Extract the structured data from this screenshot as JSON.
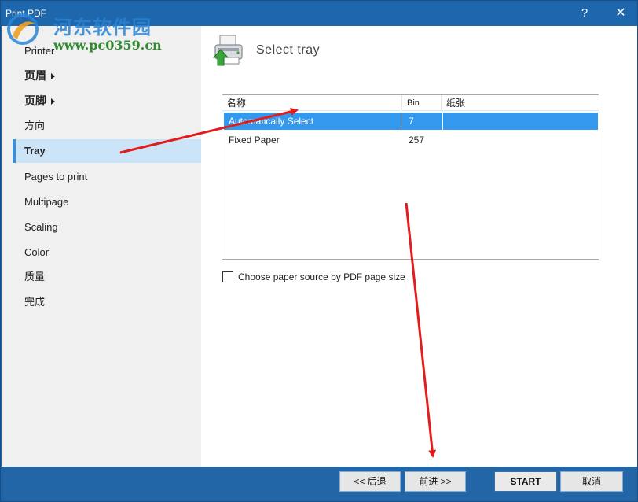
{
  "window": {
    "title": "Print PDF",
    "help_label": "?",
    "close_label": "✕"
  },
  "watermark": {
    "site_name": "河东软件园",
    "url": "www.pc0359.cn"
  },
  "sidebar": {
    "items": [
      {
        "label": "Printer",
        "selected": false,
        "bold": false,
        "submenu": false
      },
      {
        "label": "页眉",
        "selected": false,
        "bold": true,
        "submenu": true
      },
      {
        "label": "页脚",
        "selected": false,
        "bold": true,
        "submenu": true
      },
      {
        "label": "方向",
        "selected": false,
        "bold": false,
        "submenu": false
      },
      {
        "label": "Tray",
        "selected": true,
        "bold": true,
        "submenu": false
      },
      {
        "label": "Pages to print",
        "selected": false,
        "bold": false,
        "submenu": false
      },
      {
        "label": "Multipage",
        "selected": false,
        "bold": false,
        "submenu": false
      },
      {
        "label": "Scaling",
        "selected": false,
        "bold": false,
        "submenu": false
      },
      {
        "label": "Color",
        "selected": false,
        "bold": false,
        "submenu": false
      },
      {
        "label": "质量",
        "selected": false,
        "bold": false,
        "submenu": false
      },
      {
        "label": "完成",
        "selected": false,
        "bold": false,
        "submenu": false
      }
    ]
  },
  "main": {
    "section_title": "Select tray",
    "section_icon": "printer-tray-icon",
    "tray_list": {
      "columns": [
        "名称",
        "Bin",
        "纸张"
      ],
      "rows": [
        {
          "name": "Automatically Select",
          "bin": "7",
          "paper": "",
          "selected": true
        },
        {
          "name": "Fixed Paper",
          "bin": "257",
          "paper": "",
          "selected": false
        }
      ]
    },
    "checkbox": {
      "label": "Choose paper source by PDF page size",
      "checked": false
    }
  },
  "footer": {
    "back_label": "<< 后退",
    "next_label": "前进 >>",
    "start_label": "START",
    "cancel_label": "取消"
  },
  "annotations": {
    "arrow_color": "#e11d1d"
  },
  "colors": {
    "titlebar": "#1f67ac",
    "selection": "#3399ee",
    "nav_selected": "#cce4f7",
    "footer": "#2266a8"
  }
}
